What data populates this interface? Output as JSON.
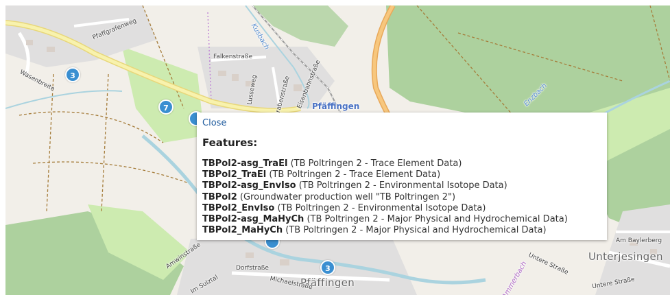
{
  "map": {
    "labels": {
      "wasenbreite": "Wasenbreite",
      "pfaffgrafenweg": "Pfaffgrafenweg",
      "falkenstrasse": "Falkenstraße",
      "lusseweg": "Lusseweg",
      "grabenstrasse": "Grabenstraße",
      "eisenbahnstrasse": "Eisenbahnstraße",
      "kusbach": "Kusbach",
      "enzbach": "Enzbach",
      "pfaffingen_station": "Pfäffingen",
      "pfaffingen_town": "Pfäffingen",
      "unterjesingen": "Unterjesingen",
      "am_baylerberg": "Am Baylerberg",
      "untere_strasse_1": "Untere Straße",
      "untere_strasse_2": "Untere Straße",
      "dorfstrasse": "Dorfstraße",
      "michaelstrasse": "Michaelstraße",
      "im_sulztal": "Im Sulztal",
      "amwinstrasse": "Amwinstraße",
      "ammerbach": "Ammerbach"
    },
    "markers": [
      {
        "count": "3"
      },
      {
        "count": "7"
      },
      {
        "count": "3"
      }
    ],
    "colors": {
      "land": "#f2efe9",
      "forest": "#add19e",
      "meadow": "#cdebb0",
      "water": "#aad3df",
      "highway": "#f7c77e",
      "marker": "#3a8fd1"
    }
  },
  "popup": {
    "close_label": "Close",
    "heading": "Features:",
    "features": [
      {
        "id": "TBPol2-asg_TraEl",
        "desc": "(TB Poltringen 2 - Trace Element Data)"
      },
      {
        "id": "TBPol2_TraEl",
        "desc": "(TB Poltringen 2 - Trace Element Data)"
      },
      {
        "id": "TBPol2-asg_EnvIso",
        "desc": "(TB Poltringen 2 - Environmental Isotope Data)"
      },
      {
        "id": "TBPol2",
        "desc": "(Groundwater production well \"TB Poltringen 2\")"
      },
      {
        "id": "TBPol2_EnvIso",
        "desc": "(TB Poltringen 2 - Environmental Isotope Data)"
      },
      {
        "id": "TBPol2-asg_MaHyCh",
        "desc": "(TB Poltringen 2 - Major Physical and Hydrochemical Data)"
      },
      {
        "id": "TBPol2_MaHyCh",
        "desc": "(TB Poltringen 2 - Major Physical and Hydrochemical Data)"
      }
    ]
  }
}
